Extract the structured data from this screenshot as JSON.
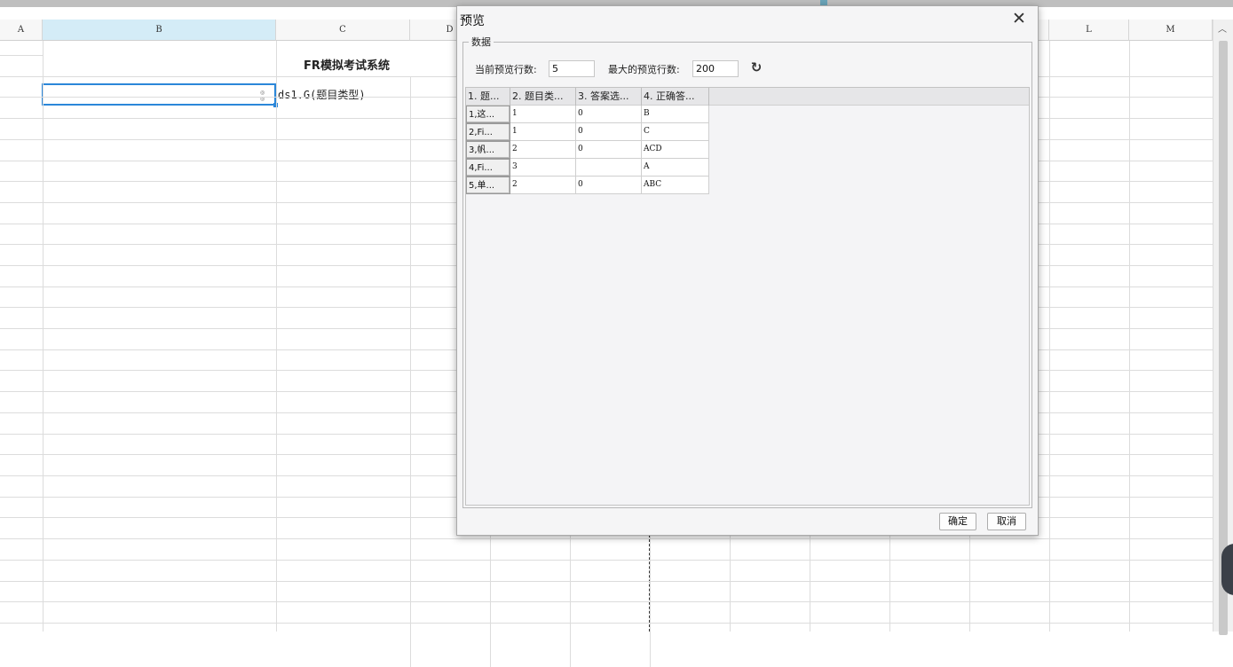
{
  "spreadsheet": {
    "columns": [
      "A",
      "B",
      "C",
      "D",
      "L",
      "M"
    ],
    "selected_column": "B",
    "title_cell": "FR模拟考试系统",
    "ds_cell": "ds1.G(题目类型)"
  },
  "dialog": {
    "title": "预览",
    "group_label": "数据",
    "current_rows_label": "当前预览行数:",
    "current_rows_value": "5",
    "max_rows_label": "最大的预览行数:",
    "max_rows_value": "200",
    "table": {
      "headers": [
        "1. 题...",
        "2. 题目类...",
        "3. 答案选...",
        "4. 正确答..."
      ],
      "rows": [
        [
          "1,这...",
          "1",
          "0",
          "B"
        ],
        [
          "2,Fi...",
          "1",
          "0",
          "C"
        ],
        [
          "3,帆...",
          "2",
          "0",
          "ACD"
        ],
        [
          "4,Fi...",
          "3",
          "",
          "A"
        ],
        [
          "5,单...",
          "2",
          "0",
          "ABC"
        ]
      ]
    },
    "ok_label": "确定",
    "cancel_label": "取消"
  },
  "colors": {
    "selection_border": "#2b87d9",
    "selected_header": "#d4ecf7"
  },
  "icons": [
    "close-icon",
    "refresh-icon",
    "chevron-up-icon"
  ]
}
